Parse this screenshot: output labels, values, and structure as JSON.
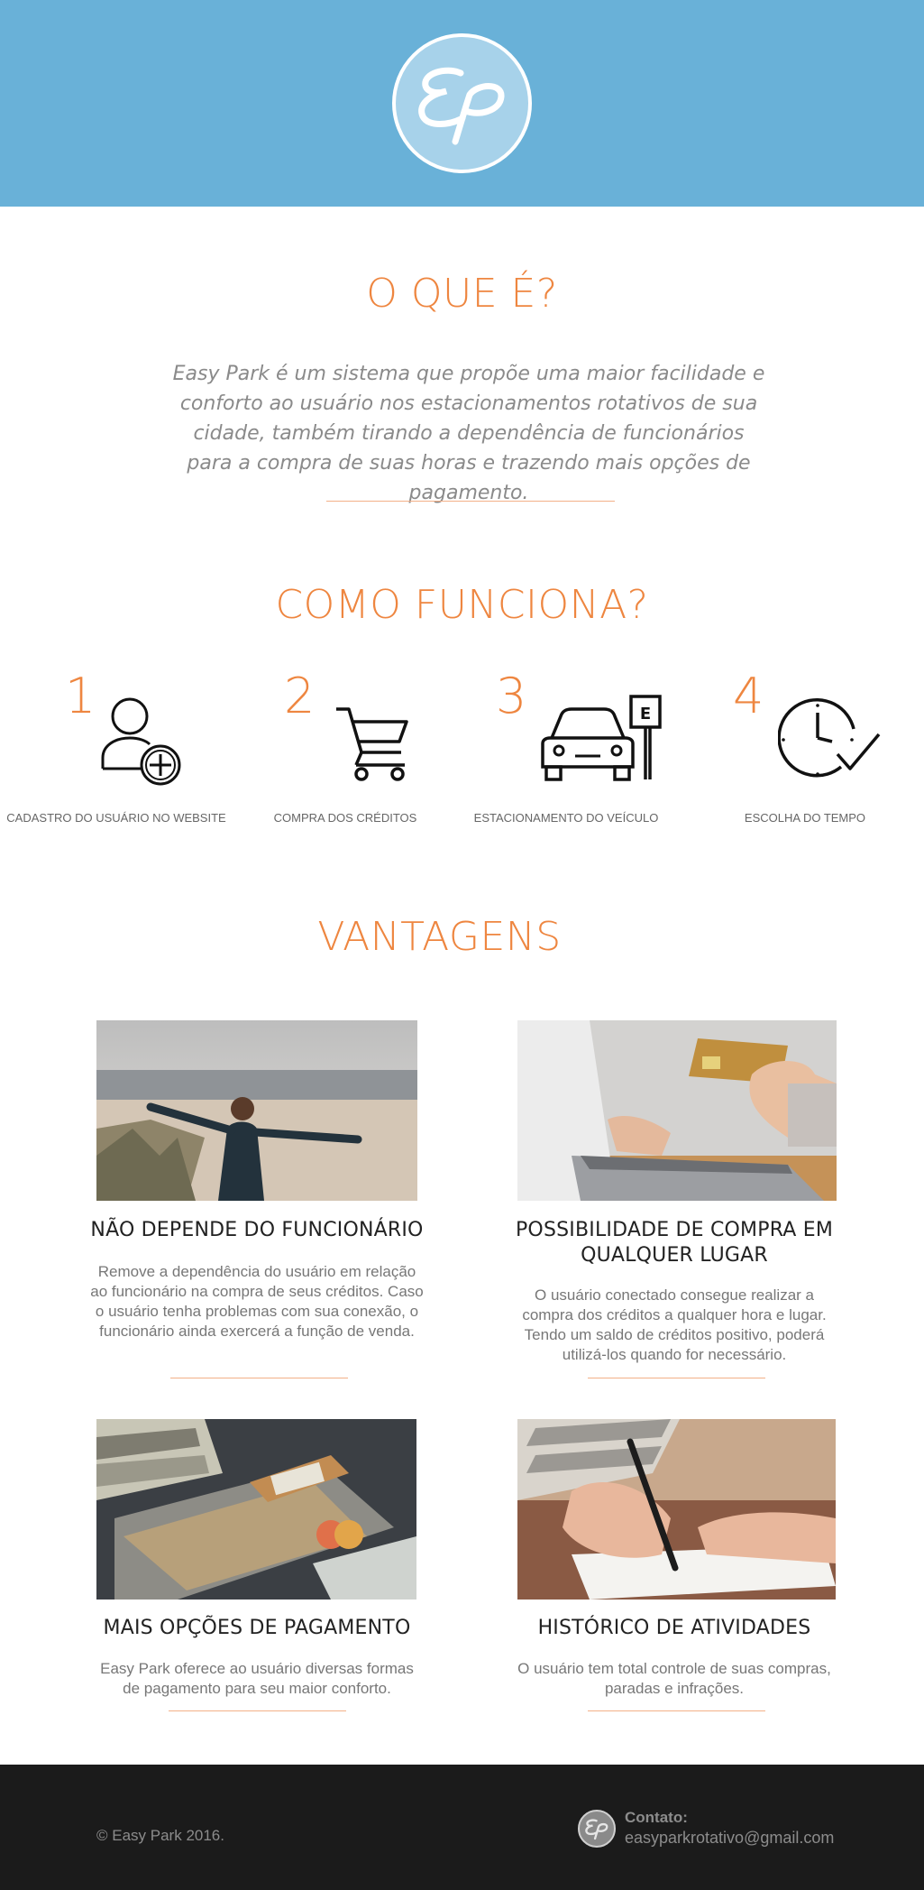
{
  "header": {
    "logo_text": "EP"
  },
  "about": {
    "title": "O QUE É?",
    "text": "Easy Park é um sistema que propõe uma maior facilidade e conforto ao usuário nos estacionamentos rotativos de sua cidade, também tirando a dependência de funcionários para a compra de suas horas e trazendo mais opções de pagamento."
  },
  "how": {
    "title": "COMO FUNCIONA?",
    "steps": [
      {
        "number": "1",
        "icon": "user-add-icon",
        "label": "CADASTRO DO USUÁRIO NO WEBSITE"
      },
      {
        "number": "2",
        "icon": "shopping-cart-icon",
        "label": "COMPRA DOS CRÉDITOS"
      },
      {
        "number": "3",
        "icon": "car-parking-icon",
        "label": "ESTACIONAMENTO DO VEÍCULO",
        "sign_letter": "E"
      },
      {
        "number": "4",
        "icon": "clock-check-icon",
        "label": "ESCOLHA DO TEMPO"
      }
    ]
  },
  "advantages": {
    "title": "VANTAGENS",
    "items": [
      {
        "title": "NÃO DEPENDE DO FUNCIONÁRIO",
        "text": "Remove a dependência do usuário em relação ao funcionário na compra de seus créditos. Caso o usuário tenha problemas com sua conexão, o funcionário ainda exercerá a função de venda."
      },
      {
        "title": "POSSIBILIDADE DE COMPRA EM QUALQUER LUGAR",
        "text": "O usuário conectado consegue realizar a compra dos créditos a qualquer hora e lugar. Tendo um saldo de créditos positivo, poderá utilizá-los quando for necessário."
      },
      {
        "title": "MAIS OPÇÕES DE PAGAMENTO",
        "text": "Easy Park oferece ao usuário diversas formas de pagamento para seu maior conforto."
      },
      {
        "title": "HISTÓRICO DE ATIVIDADES",
        "text": "O usuário tem total controle de suas compras, paradas e infrações."
      }
    ]
  },
  "footer": {
    "copyright": "© Easy Park 2016.",
    "contact_label": "Contato:",
    "contact_email": "easyparkrotativo@gmail.com"
  },
  "colors": {
    "header_bg": "#69b1d8",
    "accent": "#ee8640",
    "footer_bg": "#1b1b1b"
  }
}
